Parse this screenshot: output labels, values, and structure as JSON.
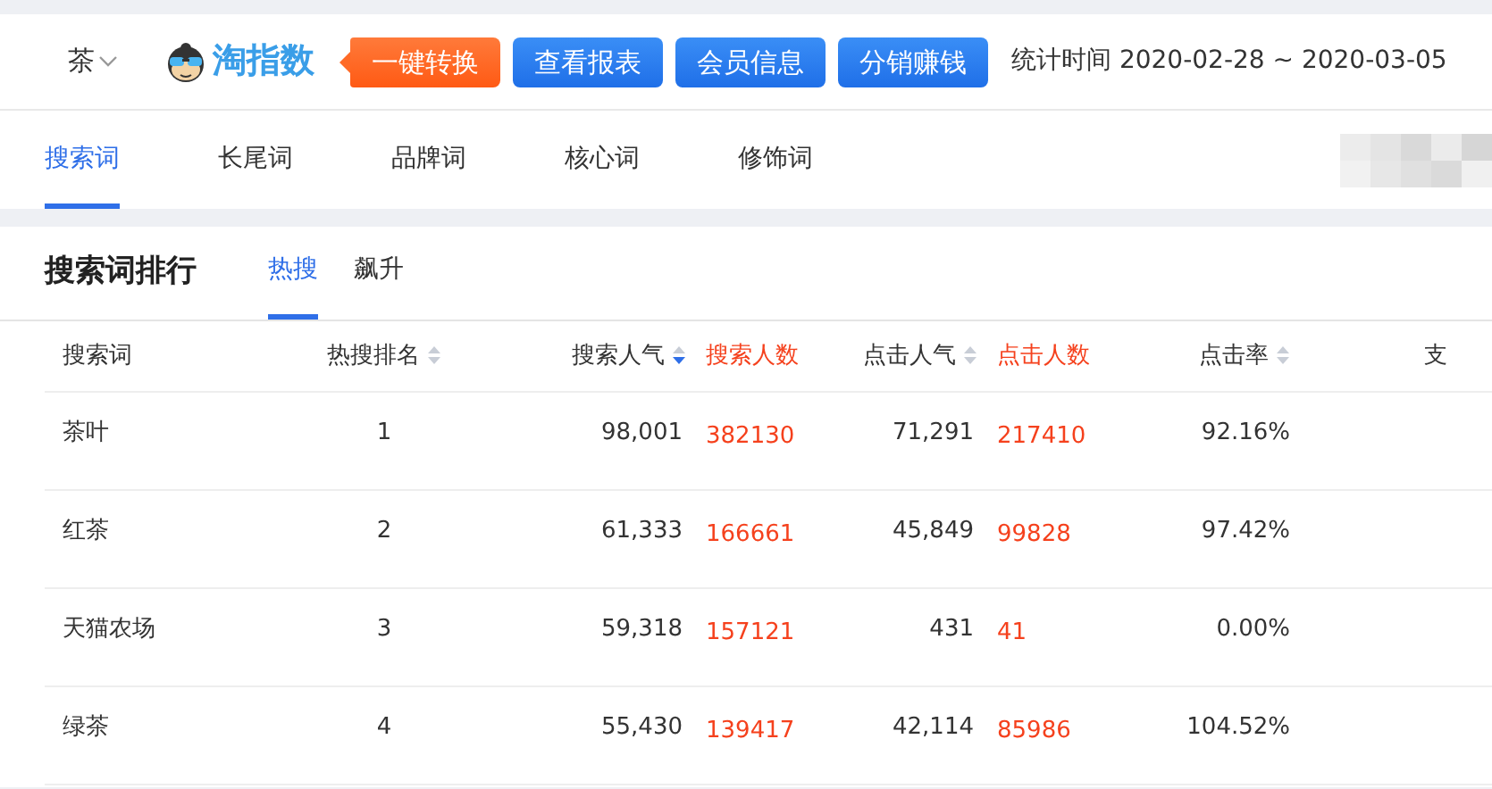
{
  "header": {
    "category": "茶",
    "logo_text": "淘指数",
    "buttons": [
      {
        "label": "一键转换",
        "kind": "convert"
      },
      {
        "label": "查看报表",
        "kind": "normal"
      },
      {
        "label": "会员信息",
        "kind": "normal"
      },
      {
        "label": "分销赚钱",
        "kind": "normal"
      }
    ],
    "stat_time": "统计时间 2020-02-28 ~ 2020-03-05"
  },
  "nav_tabs": [
    {
      "label": "搜索词",
      "selected": true
    },
    {
      "label": "长尾词",
      "selected": false
    },
    {
      "label": "品牌词",
      "selected": false
    },
    {
      "label": "核心词",
      "selected": false
    },
    {
      "label": "修饰词",
      "selected": false
    }
  ],
  "panel": {
    "title": "搜索词排行",
    "tabs": [
      {
        "label": "热搜",
        "selected": true
      },
      {
        "label": "飙升",
        "selected": false
      }
    ]
  },
  "table": {
    "columns": [
      {
        "label": "搜索词",
        "kind": "plain"
      },
      {
        "label": "热搜排名",
        "kind": "sortable",
        "sorted_desc": false
      },
      {
        "label": "搜索人气",
        "kind": "sortable",
        "sorted_desc": true
      },
      {
        "label": "搜索人数",
        "kind": "count"
      },
      {
        "label": "点击人气",
        "kind": "sortable",
        "sorted_desc": false
      },
      {
        "label": "点击人数",
        "kind": "count"
      },
      {
        "label": "点击率",
        "kind": "sortable",
        "sorted_desc": false
      },
      {
        "label": "支",
        "kind": "plain"
      }
    ],
    "rows": [
      [
        "茶叶",
        "1",
        "98,001",
        "382130",
        "71,291",
        "217410",
        "92.16%"
      ],
      [
        "红茶",
        "2",
        "61,333",
        "166661",
        "45,849",
        "99828",
        "97.42%"
      ],
      [
        "天猫农场",
        "3",
        "59,318",
        "157121",
        "431",
        "41",
        "0.00%"
      ],
      [
        "绿茶",
        "4",
        "55,430",
        "139417",
        "42,114",
        "85986",
        "104.52%"
      ]
    ]
  }
}
